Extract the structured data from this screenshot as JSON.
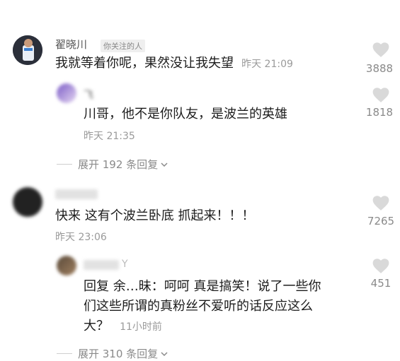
{
  "comments": [
    {
      "username": "翟晓川",
      "badge": "你关注的人",
      "text": "我就等着你呢，果然没让我失望",
      "time": "昨天 21:09",
      "likes": "3888",
      "replies": [
        {
          "username": "飞",
          "text": "川哥，他不是你队友，是波兰的英雄",
          "time": "昨天 21:35",
          "likes": "1818"
        }
      ],
      "expand_label": "展开 192 条回复"
    },
    {
      "username": "",
      "text": "快来 这有个波兰卧底 抓起来！！！",
      "time": "昨天 23:06",
      "likes": "7265",
      "replies": [
        {
          "username": "Y",
          "text_line1": "回复 余…昧：呵呵 真是搞笑！说了一些你",
          "text_line2": "们这些所谓的真粉丝不爱听的话反应这么",
          "text_line3": "大？",
          "time": "11小时前",
          "likes": "451"
        }
      ],
      "expand_label": "展开 310 条回复"
    }
  ],
  "colors": {
    "text": "#1c1c1c",
    "meta": "#9a9a9a",
    "heart": "#d9d9d9"
  },
  "icons": {
    "like": "heart-icon",
    "expand": "chevron-down-icon"
  }
}
